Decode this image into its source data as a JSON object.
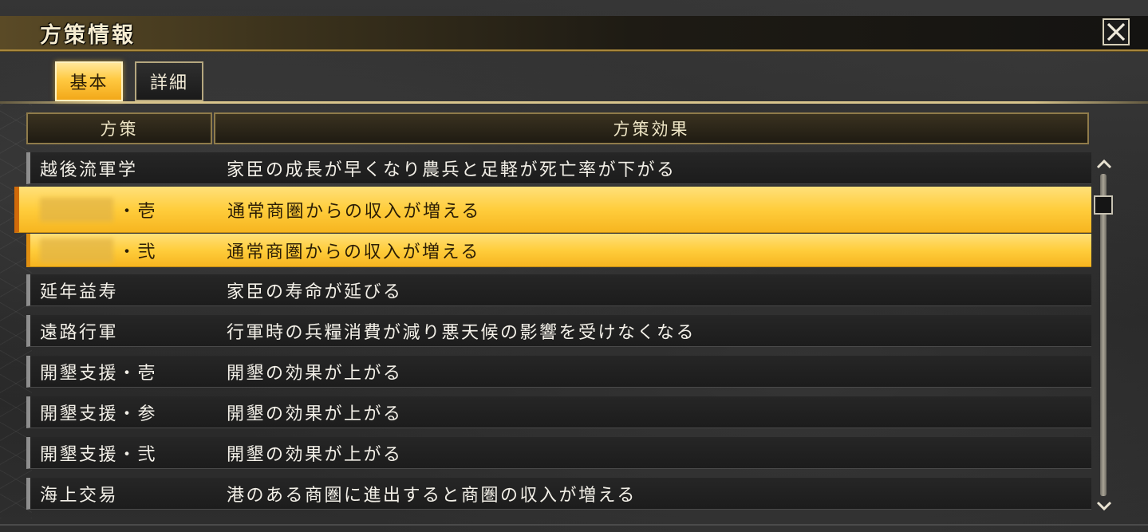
{
  "window": {
    "title": "方策情報"
  },
  "tabs": [
    {
      "label": "基本",
      "active": true
    },
    {
      "label": "詳細",
      "active": false
    }
  ],
  "table": {
    "columns": [
      "方策",
      "方策効果"
    ],
    "rows": [
      {
        "name": "越後流軍学",
        "effect": "家臣の成長が早くなり農兵と足軽が死亡率が下がる",
        "selected": false
      },
      {
        "name": "・壱",
        "name_redacted": true,
        "effect": "通常商圏からの収入が増える",
        "selected": true
      },
      {
        "name": "・弐",
        "name_redacted": true,
        "effect": "通常商圏からの収入が増える",
        "selected": true
      },
      {
        "name": "延年益寿",
        "effect": "家臣の寿命が延びる",
        "selected": false
      },
      {
        "name": "遠路行軍",
        "effect": "行軍時の兵糧消費が減り悪天候の影響を受けなくなる",
        "selected": false
      },
      {
        "name": "開墾支援・壱",
        "effect": "開墾の効果が上がる",
        "selected": false
      },
      {
        "name": "開墾支援・参",
        "effect": "開墾の効果が上がる",
        "selected": false
      },
      {
        "name": "開墾支援・弐",
        "effect": "開墾の効果が上がる",
        "selected": false
      },
      {
        "name": "海上交易",
        "effect": "港のある商圏に進出すると商圏の収入が増える",
        "selected": false
      }
    ]
  },
  "icons": {
    "close": "close-icon",
    "scroll_up": "chevron-up-icon",
    "scroll_down": "chevron-down-icon"
  },
  "colors": {
    "accent_gold": "#ffcd3c",
    "frame_gold": "#a8873c",
    "row_dark": "#1c1c1c",
    "text_light": "#f3f0e8"
  }
}
